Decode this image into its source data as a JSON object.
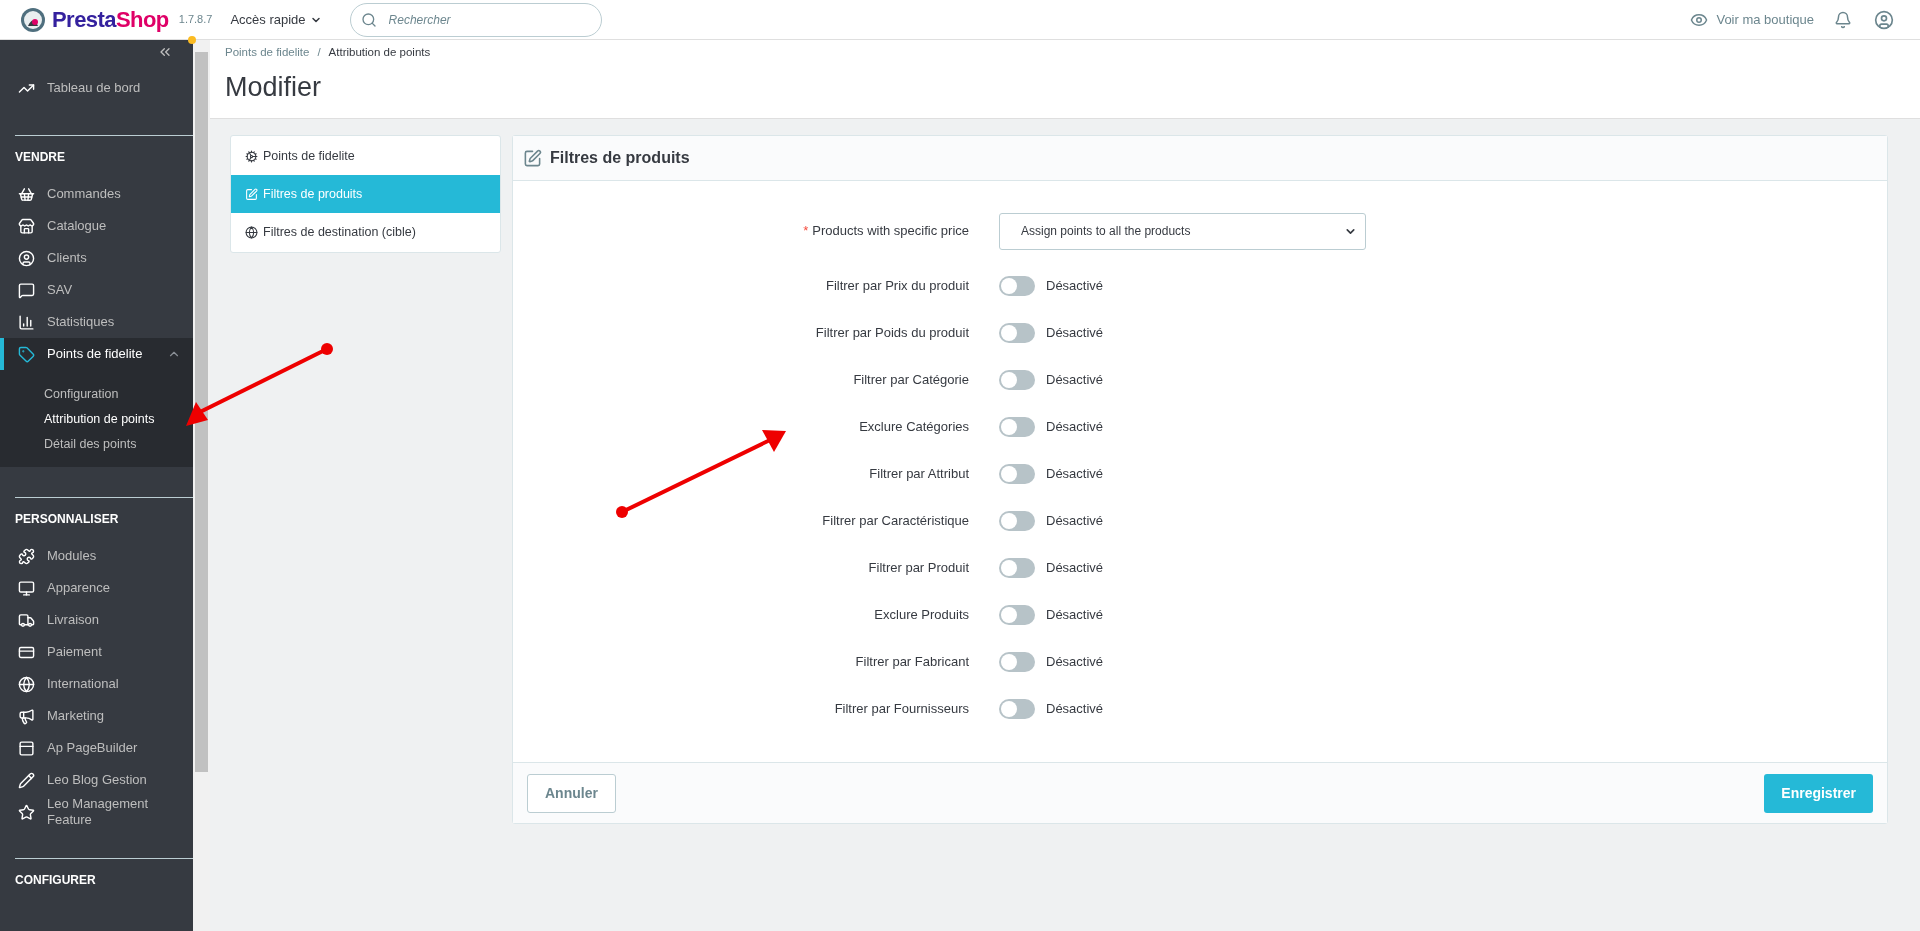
{
  "topbar": {
    "logo_part1": "Presta",
    "logo_part2": "Shop",
    "version": "1.7.8.7",
    "quick_access": "Accès rapide",
    "search": {
      "placeholder": "Rechercher"
    },
    "view_shop": "Voir ma boutique"
  },
  "sidebar": {
    "sections": [
      {
        "items": [
          {
            "label": "Tableau de bord",
            "selected": false,
            "expanded": false
          }
        ]
      },
      {
        "title": "VENDRE",
        "items": [
          {
            "label": "Commandes",
            "selected": false,
            "expanded": false
          },
          {
            "label": "Catalogue",
            "selected": false,
            "expanded": false
          },
          {
            "label": "Clients",
            "selected": false,
            "expanded": false
          },
          {
            "label": "SAV",
            "selected": false,
            "expanded": false
          },
          {
            "label": "Statistiques",
            "selected": false,
            "expanded": false
          },
          {
            "label": "Points de fidelite",
            "selected": true,
            "expanded": true,
            "children": [
              {
                "label": "Configuration",
                "selected": false
              },
              {
                "label": "Attribution de points",
                "selected": true
              },
              {
                "label": "Détail des points",
                "selected": false
              }
            ]
          }
        ]
      },
      {
        "title": "PERSONNALISER",
        "items": [
          {
            "label": "Modules",
            "selected": false,
            "expanded": false
          },
          {
            "label": "Apparence",
            "selected": false,
            "expanded": false
          },
          {
            "label": "Livraison",
            "selected": false,
            "expanded": false
          },
          {
            "label": "Paiement",
            "selected": false,
            "expanded": false
          },
          {
            "label": "International",
            "selected": false,
            "expanded": false
          },
          {
            "label": "Marketing",
            "selected": false,
            "expanded": false
          },
          {
            "label": "Ap PageBuilder",
            "selected": false,
            "expanded": false
          },
          {
            "label": "Leo Blog Gestion",
            "selected": false,
            "expanded": false
          },
          {
            "label": "Leo Management Feature",
            "selected": false,
            "expanded": false
          }
        ]
      },
      {
        "title": "CONFIGURER"
      }
    ]
  },
  "breadcrumb": {
    "separator": "/",
    "items": [
      "Points de fidelite",
      "Attribution de points"
    ]
  },
  "page_title": "Modifier",
  "tabs": [
    {
      "label": "Points de fidelite",
      "selected": false
    },
    {
      "label": "Filtres de produits",
      "selected": true
    },
    {
      "label": "Filtres de destination (cible)",
      "selected": false
    }
  ],
  "panel": {
    "title": "Filtres de produits",
    "select": {
      "label": "Products with specific price",
      "required_mark": "*",
      "value": "Assign points to all the products"
    },
    "toggles": [
      {
        "label": "Filtrer par Prix du produit",
        "on": false,
        "state": "Désactivé"
      },
      {
        "label": "Filtrer par Poids du produit",
        "on": false,
        "state": "Désactivé"
      },
      {
        "label": "Filtrer par Catégorie",
        "on": false,
        "state": "Désactivé"
      },
      {
        "label": "Exclure Catégories",
        "on": false,
        "state": "Désactivé"
      },
      {
        "label": "Filtrer par Attribut",
        "on": false,
        "state": "Désactivé"
      },
      {
        "label": "Filtrer par Caractéristique",
        "on": false,
        "state": "Désactivé"
      },
      {
        "label": "Filtrer par Produit",
        "on": false,
        "state": "Désactivé"
      },
      {
        "label": "Exclure Produits",
        "on": false,
        "state": "Désactivé"
      },
      {
        "label": "Filtrer par Fabricant",
        "on": false,
        "state": "Désactivé"
      },
      {
        "label": "Filtrer par Fournisseurs",
        "on": false,
        "state": "Désactivé"
      }
    ],
    "cancel": "Annuler",
    "save": "Enregistrer"
  }
}
